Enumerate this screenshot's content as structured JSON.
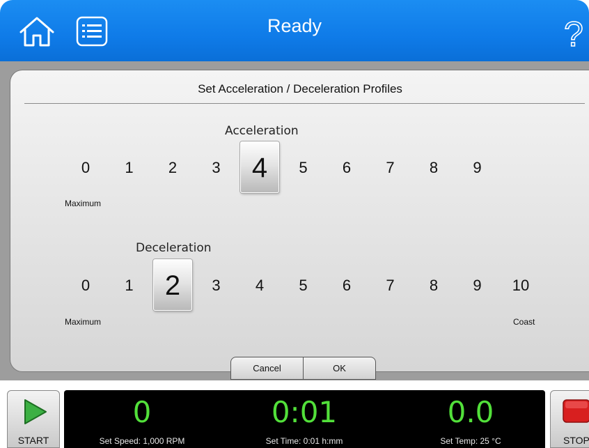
{
  "header": {
    "title": "Ready",
    "home_icon": "home-icon",
    "menu_icon": "list-icon",
    "help_glyph": "?"
  },
  "dialog": {
    "title": "Set Acceleration / Deceleration Profiles",
    "acceleration": {
      "label": "Acceleration",
      "options": [
        "0",
        "1",
        "2",
        "3",
        "4",
        "5",
        "6",
        "7",
        "8",
        "9"
      ],
      "selected": "4",
      "min_label": "Maximum"
    },
    "deceleration": {
      "label": "Deceleration",
      "options": [
        "0",
        "1",
        "2",
        "3",
        "4",
        "5",
        "6",
        "7",
        "8",
        "9",
        "10"
      ],
      "selected": "2",
      "min_label": "Maximum",
      "max_label": "Coast"
    },
    "cancel_label": "Cancel",
    "ok_label": "OK"
  },
  "controls": {
    "start_label": "START",
    "stop_label": "STOP",
    "speed_value": "0",
    "speed_label": "Set Speed: 1,000 RPM",
    "time_value": "0:01",
    "time_label": "Set Time: 0:01 h:mm",
    "temp_value": "0.0",
    "temp_label": "Set Temp: 25 °C"
  },
  "colors": {
    "header_blue": "#0f7be8",
    "readout_green": "#52e03a",
    "stop_red": "#d81f1f",
    "start_green": "#3cb043"
  }
}
